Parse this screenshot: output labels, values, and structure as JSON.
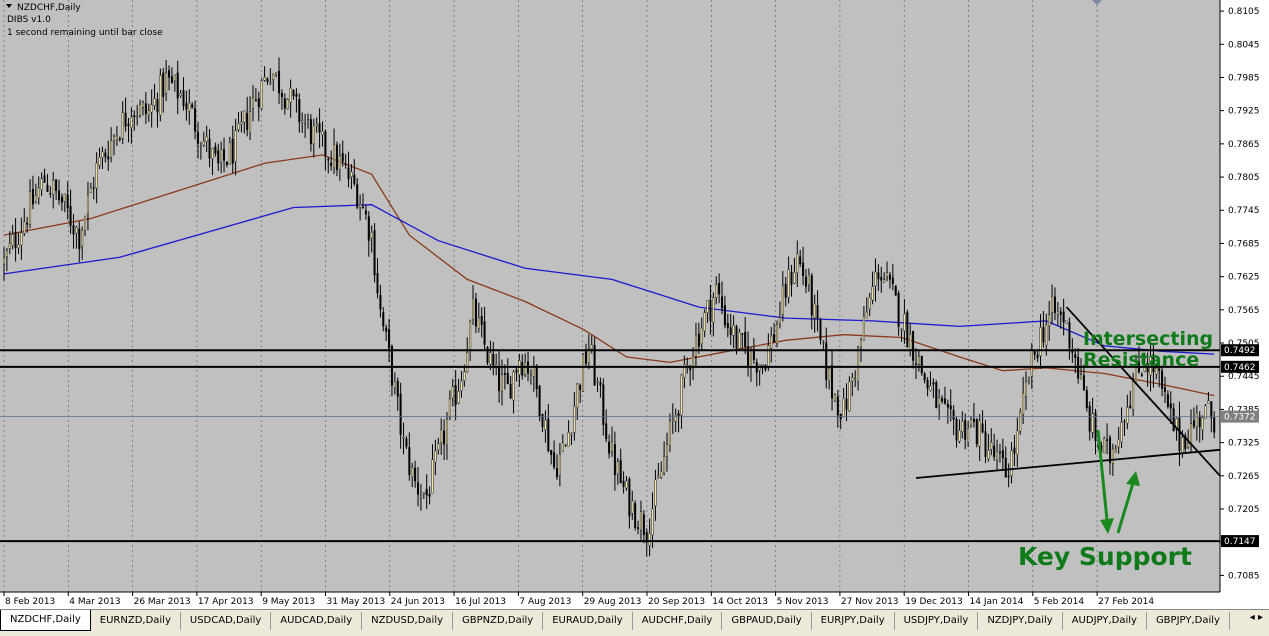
{
  "header": {
    "symbol": "NZDCHF,Daily",
    "indicator": "DIBS v1.0",
    "timer": "1 second remaining until bar close"
  },
  "chart_data": {
    "type": "candlestick",
    "symbol": "NZDCHF",
    "timeframe": "Daily",
    "ylim": [
      0.7055,
      0.8125
    ],
    "y_ticks": [
      "0.8105",
      "0.8045",
      "0.7985",
      "0.7925",
      "0.7865",
      "0.7805",
      "0.7745",
      "0.7685",
      "0.7625",
      "0.7565",
      "0.7505",
      "0.7445",
      "0.7385",
      "0.7325",
      "0.7265",
      "0.7205",
      "0.7145",
      "0.7085"
    ],
    "x_ticks": [
      "8 Feb 2013",
      "4 Mar 2013",
      "26 Mar 2013",
      "17 Apr 2013",
      "9 May 2013",
      "31 May 2013",
      "24 Jun 2013",
      "16 Jul 2013",
      "7 Aug 2013",
      "29 Aug 2013",
      "20 Sep 2013",
      "14 Oct 2013",
      "5 Nov 2013",
      "27 Nov 2013",
      "19 Dec 2013",
      "14 Jan 2014",
      "5 Feb 2014",
      "27 Feb 2014"
    ],
    "close_path": [
      [
        0,
        0.765
      ],
      [
        8,
        0.774
      ],
      [
        14,
        0.78
      ],
      [
        20,
        0.776
      ],
      [
        26,
        0.77
      ],
      [
        32,
        0.782
      ],
      [
        38,
        0.788
      ],
      [
        44,
        0.793
      ],
      [
        50,
        0.792
      ],
      [
        56,
        0.798
      ],
      [
        62,
        0.795
      ],
      [
        68,
        0.788
      ],
      [
        74,
        0.782
      ],
      [
        80,
        0.786
      ],
      [
        86,
        0.794
      ],
      [
        92,
        0.8
      ],
      [
        98,
        0.795
      ],
      [
        104,
        0.79
      ],
      [
        110,
        0.786
      ],
      [
        116,
        0.783
      ],
      [
        122,
        0.778
      ],
      [
        127,
        0.77
      ],
      [
        130,
        0.756
      ],
      [
        134,
        0.745
      ],
      [
        138,
        0.732
      ],
      [
        142,
        0.725
      ],
      [
        146,
        0.723
      ],
      [
        150,
        0.73
      ],
      [
        154,
        0.738
      ],
      [
        158,
        0.745
      ],
      [
        162,
        0.756
      ],
      [
        166,
        0.75
      ],
      [
        170,
        0.744
      ],
      [
        174,
        0.742
      ],
      [
        178,
        0.748
      ],
      [
        182,
        0.746
      ],
      [
        186,
        0.738
      ],
      [
        190,
        0.728
      ],
      [
        194,
        0.732
      ],
      [
        198,
        0.742
      ],
      [
        202,
        0.75
      ],
      [
        206,
        0.74
      ],
      [
        210,
        0.73
      ],
      [
        214,
        0.724
      ],
      [
        218,
        0.72
      ],
      [
        222,
        0.717
      ],
      [
        226,
        0.725
      ],
      [
        230,
        0.734
      ],
      [
        234,
        0.742
      ],
      [
        238,
        0.75
      ],
      [
        242,
        0.755
      ],
      [
        246,
        0.76
      ],
      [
        250,
        0.754
      ],
      [
        254,
        0.75
      ],
      [
        258,
        0.748
      ],
      [
        262,
        0.747
      ],
      [
        266,
        0.752
      ],
      [
        270,
        0.76
      ],
      [
        274,
        0.766
      ],
      [
        278,
        0.76
      ],
      [
        282,
        0.75
      ],
      [
        286,
        0.742
      ],
      [
        290,
        0.738
      ],
      [
        294,
        0.746
      ],
      [
        298,
        0.756
      ],
      [
        302,
        0.764
      ],
      [
        306,
        0.76
      ],
      [
        310,
        0.755
      ],
      [
        314,
        0.75
      ],
      [
        318,
        0.744
      ],
      [
        322,
        0.74
      ],
      [
        326,
        0.736
      ],
      [
        330,
        0.735
      ],
      [
        334,
        0.736
      ],
      [
        338,
        0.733
      ],
      [
        342,
        0.73
      ],
      [
        346,
        0.727
      ],
      [
        350,
        0.733
      ],
      [
        354,
        0.745
      ],
      [
        358,
        0.752
      ],
      [
        362,
        0.756
      ],
      [
        366,
        0.755
      ],
      [
        370,
        0.748
      ],
      [
        374,
        0.738
      ],
      [
        378,
        0.732
      ],
      [
        382,
        0.73
      ],
      [
        386,
        0.737
      ],
      [
        390,
        0.743
      ],
      [
        394,
        0.748
      ],
      [
        398,
        0.745
      ],
      [
        402,
        0.738
      ],
      [
        406,
        0.733
      ],
      [
        410,
        0.735
      ],
      [
        414,
        0.738
      ],
      [
        418,
        0.7372
      ]
    ],
    "sma_200": [
      [
        0,
        0.763
      ],
      [
        40,
        0.766
      ],
      [
        80,
        0.772
      ],
      [
        100,
        0.775
      ],
      [
        127,
        0.7755
      ],
      [
        150,
        0.769
      ],
      [
        180,
        0.764
      ],
      [
        210,
        0.762
      ],
      [
        240,
        0.757
      ],
      [
        270,
        0.755
      ],
      [
        300,
        0.7545
      ],
      [
        330,
        0.7535
      ],
      [
        360,
        0.7545
      ],
      [
        380,
        0.75
      ],
      [
        400,
        0.749
      ],
      [
        418,
        0.7485
      ]
    ],
    "sma_100": [
      [
        0,
        0.77
      ],
      [
        30,
        0.773
      ],
      [
        60,
        0.778
      ],
      [
        90,
        0.783
      ],
      [
        110,
        0.7845
      ],
      [
        127,
        0.781
      ],
      [
        140,
        0.77
      ],
      [
        160,
        0.762
      ],
      [
        180,
        0.758
      ],
      [
        200,
        0.753
      ],
      [
        215,
        0.748
      ],
      [
        230,
        0.747
      ],
      [
        250,
        0.749
      ],
      [
        270,
        0.751
      ],
      [
        290,
        0.752
      ],
      [
        310,
        0.7515
      ],
      [
        330,
        0.748
      ],
      [
        345,
        0.7455
      ],
      [
        360,
        0.746
      ],
      [
        380,
        0.745
      ],
      [
        400,
        0.743
      ],
      [
        418,
        0.741
      ]
    ],
    "levels": [
      {
        "value": 0.7492,
        "label": "0.7492"
      },
      {
        "value": 0.7462,
        "label": "0.7462"
      },
      {
        "value": 0.7147,
        "label": "0.7147"
      }
    ],
    "current_price": {
      "value": 0.7372,
      "label": "0.7372"
    },
    "trendlines": [
      {
        "x1": 367,
        "y1": 0.757,
        "x2": 420,
        "y2": 0.7265
      },
      {
        "x1": 315,
        "y1": 0.7261,
        "x2": 420,
        "y2": 0.7312
      }
    ],
    "annotations": {
      "resistance_line1": "Intersecting",
      "resistance_line2": "Resistance",
      "support": "Key Support"
    }
  },
  "tabs": [
    "NZDCHF,Daily",
    "EURNZD,Daily",
    "USDCAD,Daily",
    "AUDCAD,Daily",
    "NZDUSD,Daily",
    "GBPNZD,Daily",
    "EURAUD,Daily",
    "AUDCHF,Daily",
    "GBPAUD,Daily",
    "EURJPY,Daily",
    "USDJPY,Daily",
    "NZDJPY,Daily",
    "AUDJPY,Daily",
    "GBPJPY,Daily"
  ],
  "tab_arrows": "◂ ▸",
  "colors": {
    "background": "#c0c0c0",
    "bull": "#f5e6a6",
    "bear": "#000000",
    "sma_200": "#1b1ad0",
    "sma_100": "#8a3a1a",
    "annotation": "#0f7a1a",
    "grid": "#000000"
  }
}
